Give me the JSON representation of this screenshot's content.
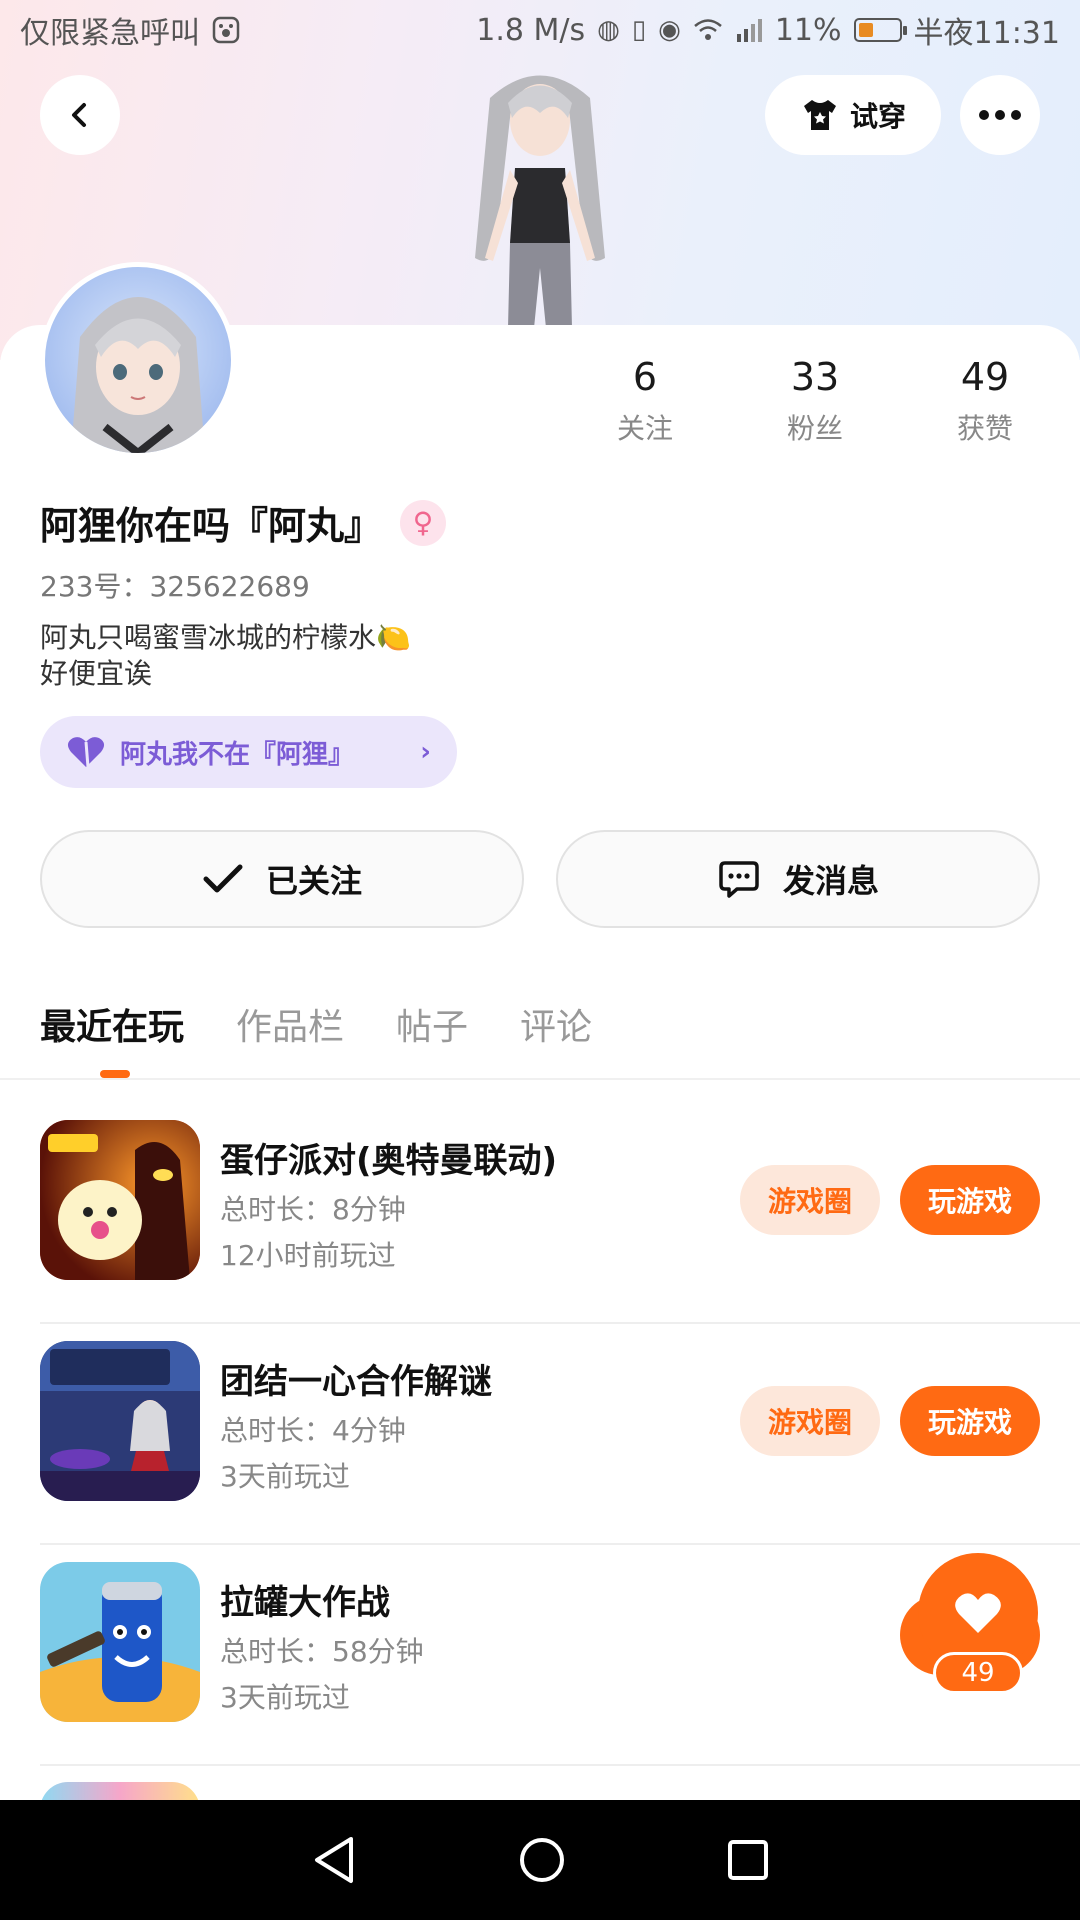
{
  "status_bar": {
    "left_text": "仅限紧急呼叫",
    "speed": "1.8 M/s",
    "battery": "11%",
    "time": "半夜11:31"
  },
  "header": {
    "tryon_label": "试穿"
  },
  "profile": {
    "stats": [
      {
        "value": "6",
        "label": "关注"
      },
      {
        "value": "33",
        "label": "粉丝"
      },
      {
        "value": "49",
        "label": "获赞"
      }
    ],
    "nickname": "阿狸你在吗『阿丸』",
    "gender_symbol": "♀",
    "uid": "233号：325622689",
    "bio_line1": "阿丸只喝蜜雪冰城的柠檬水🍋",
    "bio_line2": "好便宜诶",
    "cp_label": "阿丸我不在『阿狸』",
    "followed_label": "已关注",
    "message_label": "发消息"
  },
  "tabs": [
    "最近在玩",
    "作品栏",
    "帖子",
    "评论"
  ],
  "games": [
    {
      "title": "蛋仔派对(奥特曼联动)",
      "duration": "总时长：8分钟",
      "last": "12小时前玩过",
      "circle_label": "游戏圈",
      "play_label": "玩游戏"
    },
    {
      "title": "团结一心合作解谜",
      "duration": "总时长：4分钟",
      "last": "3天前玩过",
      "circle_label": "游戏圈",
      "play_label": "玩游戏"
    },
    {
      "title": "拉罐大作战",
      "duration": "总时长：58分钟",
      "last": "3天前玩过"
    }
  ],
  "like_fab": {
    "count": "49"
  },
  "colors": {
    "accent": "#ff6a13",
    "purple": "#7c5cd6",
    "pink": "#f0668e"
  }
}
